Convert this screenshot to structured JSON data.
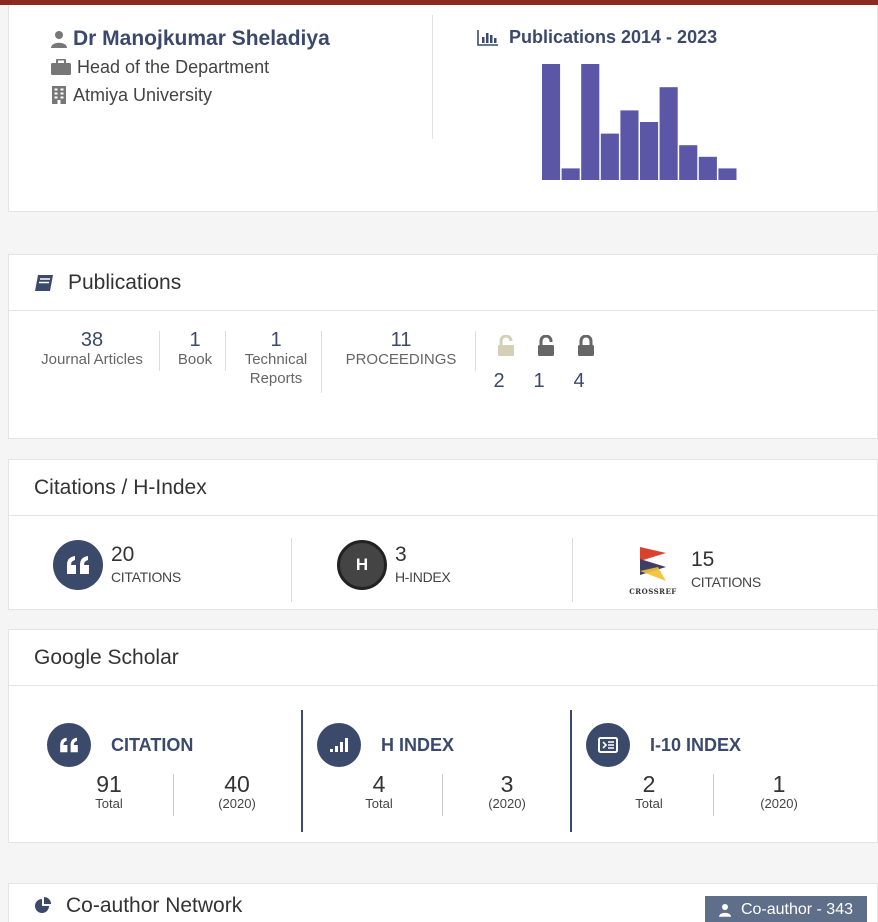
{
  "profile": {
    "name": "Dr Manojkumar Sheladiya",
    "position": "Head of the Department",
    "institution": "Atmiya University"
  },
  "publications_chart": {
    "title": "Publications 2014 - 2023",
    "color": "#5b57a6"
  },
  "chart_data": {
    "type": "bar",
    "title": "Publications 2014 - 2023",
    "categories": [
      "2014",
      "2015",
      "2016",
      "2017",
      "2018",
      "2019",
      "2020",
      "2021",
      "2022",
      "2023"
    ],
    "values": [
      10,
      1,
      10,
      4,
      6,
      5,
      8,
      3,
      2,
      1
    ],
    "ylim": [
      0,
      10
    ]
  },
  "publications": {
    "title": "Publications",
    "stats": [
      {
        "count": "38",
        "label_lines": [
          "Journal Articles"
        ]
      },
      {
        "count": "1",
        "label_lines": [
          "Book"
        ]
      },
      {
        "count": "1",
        "label_lines": [
          "Technical",
          "Reports"
        ]
      },
      {
        "count": "11",
        "label_lines": [
          "PROCEEDINGS"
        ]
      }
    ],
    "access": [
      {
        "icon": "unlock-open-icon",
        "count": "2",
        "color": "#d6cfb7"
      },
      {
        "icon": "unlock-icon",
        "count": "1",
        "color": "#666666"
      },
      {
        "icon": "lock-icon",
        "count": "4",
        "color": "#666666"
      }
    ]
  },
  "citations": {
    "title": "Citations / H-Index",
    "items": [
      {
        "icon": "quote-icon",
        "value": "20",
        "label": "CITATIONS"
      },
      {
        "icon": "h-index-icon",
        "icon_text": "H",
        "value": "3",
        "label": "H-INDEX"
      },
      {
        "icon": "crossref-icon",
        "icon_text": "CROSSREF",
        "value": "15",
        "label": "CITATIONS"
      }
    ]
  },
  "google_scholar": {
    "title": "Google Scholar",
    "columns": [
      {
        "icon": "quote-icon",
        "label": "CITATION",
        "total": "91",
        "total_label": "Total",
        "recent": "40",
        "recent_label": "(2020)"
      },
      {
        "icon": "signal-icon",
        "label": "H INDEX",
        "total": "4",
        "total_label": "Total",
        "recent": "3",
        "recent_label": "(2020)"
      },
      {
        "icon": "list-icon",
        "label": "I-10 INDEX",
        "total": "2",
        "total_label": "Total",
        "recent": "1",
        "recent_label": "(2020)"
      }
    ]
  },
  "coauthor": {
    "title": "Co-author Network",
    "badge": "Co-author - 343"
  },
  "colors": {
    "accent": "#3b4a6b",
    "topbar": "#8b2a23"
  }
}
